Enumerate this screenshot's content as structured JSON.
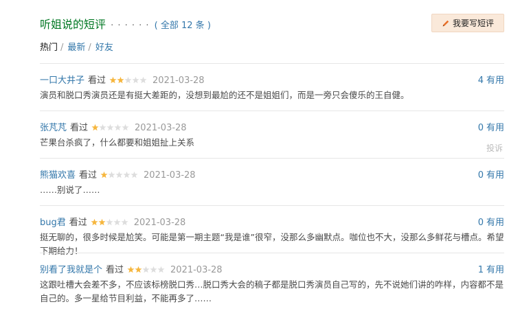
{
  "header": {
    "title": "听姐说的短评",
    "dots": "· · · · · ·",
    "all_count": "( 全部 12 条 )",
    "write_button": "我要写短评"
  },
  "tabs": [
    {
      "label": "热门",
      "active": true
    },
    {
      "label": "最新",
      "active": false
    },
    {
      "label": "好友",
      "active": false
    }
  ],
  "tab_separator": "/",
  "watched_label": "看过",
  "useful_label": "有用",
  "report_label": "投诉",
  "colors": {
    "brand_green": "#007722",
    "link_blue": "#3377aa",
    "star_gold": "#f6b63d",
    "star_gray": "#dddddd",
    "button_bg": "#fae9da"
  },
  "icons": {
    "write": "pencil-icon",
    "rating": "star-icon"
  },
  "comments": [
    {
      "author": "一口大井子",
      "rating": 2,
      "max_rating": 5,
      "date": "2021-03-28",
      "useful_count": "4",
      "content": "演员和脱口秀演员还是有挺大差距的，没想到最尬的还不是姐姐们，而是一旁只会傻乐的王自健。"
    },
    {
      "author": "张芃芃",
      "rating": 1,
      "max_rating": 5,
      "date": "2021-03-28",
      "useful_count": "0",
      "content": "芒果台杀疯了，什么都要和姐姐扯上关系",
      "show_report": true
    },
    {
      "author": "熊猫欢喜",
      "rating": 1,
      "max_rating": 5,
      "date": "2021-03-28",
      "useful_count": "0",
      "content": "……别说了……"
    },
    {
      "author": "bug君",
      "rating": 2,
      "max_rating": 5,
      "date": "2021-03-28",
      "useful_count": "0",
      "content": "挺无聊的，很多时候是尬笑。可能是第一期主题“我是谁”很窄，没那么多幽默点。咖位也不大，没那么多鲜花与槽点。希望下期给力！"
    },
    {
      "author": "别看了我就是个",
      "rating": 2,
      "max_rating": 5,
      "date": "2021-03-28",
      "useful_count": "1",
      "content": "这跟吐槽大会差不多，不应该标榜脱口秀…脱口秀大会的稿子都是脱口秀演员自己写的，先不说她们讲的咋样，内容都不是自己的。多一星给节目利益，不能再多了……"
    }
  ]
}
